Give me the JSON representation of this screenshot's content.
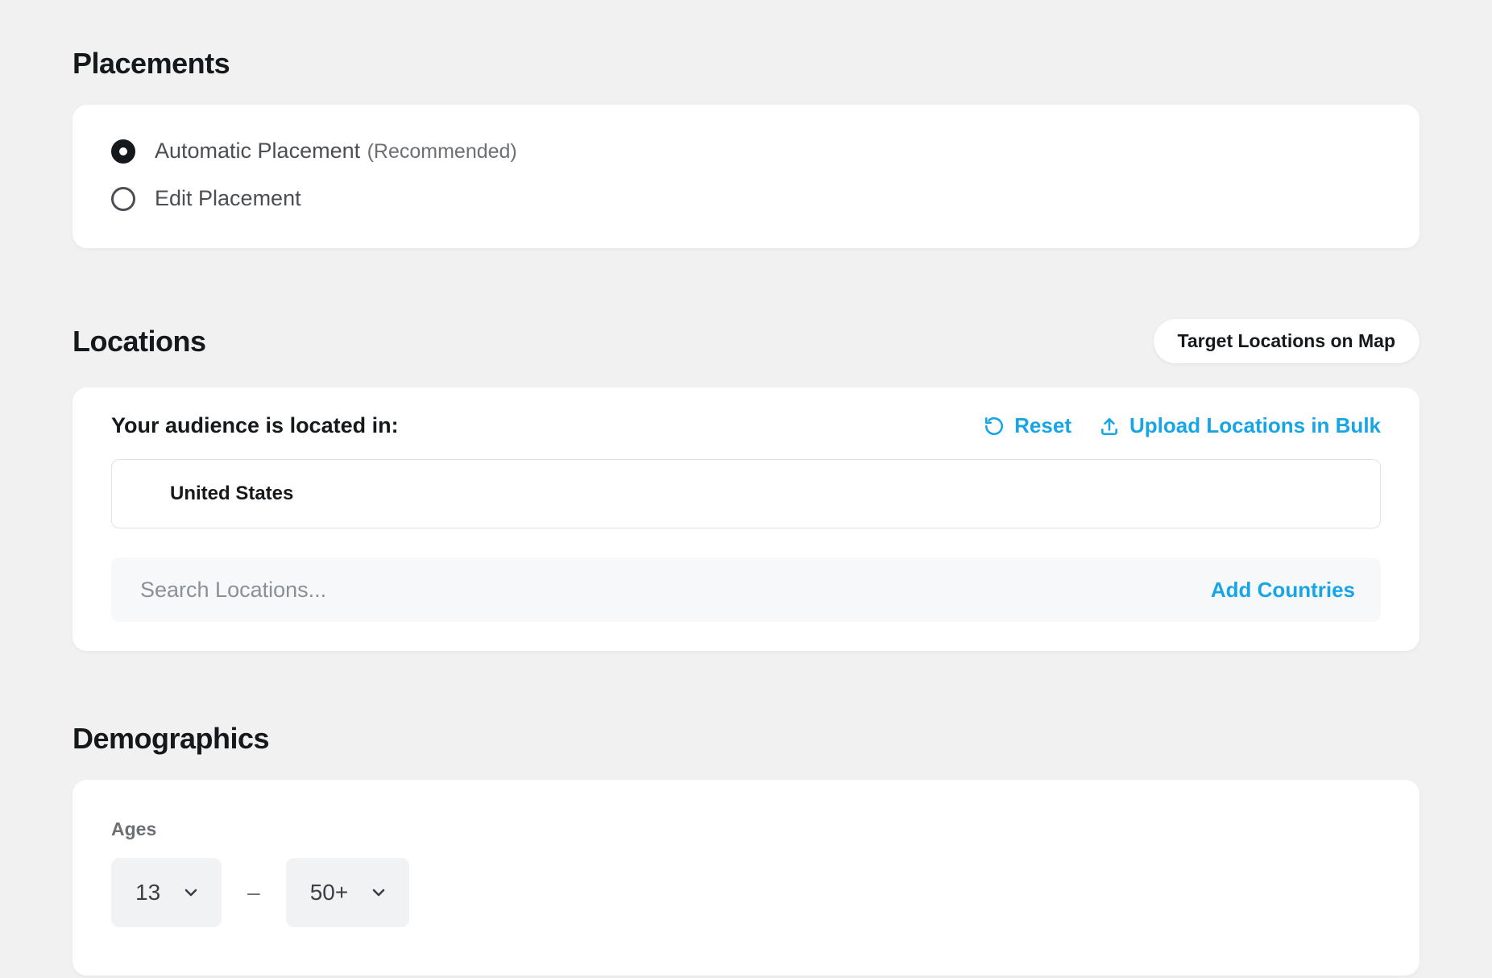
{
  "placements": {
    "title": "Placements",
    "options": {
      "auto": {
        "label": "Automatic Placement",
        "note": "(Recommended)"
      },
      "edit": {
        "label": "Edit Placement"
      }
    }
  },
  "locations": {
    "title": "Locations",
    "map_button": "Target Locations on Map",
    "header_label": "Your audience is located in:",
    "reset_label": "Reset",
    "upload_label": "Upload Locations in Bulk",
    "selected_location": "United States",
    "search_placeholder": "Search Locations...",
    "add_countries_label": "Add Countries"
  },
  "demographics": {
    "title": "Demographics",
    "ages_label": "Ages",
    "age_min": "13",
    "age_max": "50+",
    "dash": "–"
  }
}
